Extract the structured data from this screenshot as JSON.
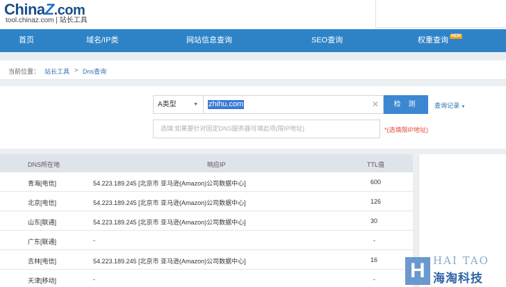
{
  "header": {
    "logo_left": "China",
    "logo_z": "Z",
    "logo_right": ".com",
    "subtitle": "tool.chinaz.com | 站长工具"
  },
  "nav": {
    "items": [
      {
        "label": "首页"
      },
      {
        "label": "域名/IP类"
      },
      {
        "label": "网站信息查询"
      },
      {
        "label": "SEO查询"
      },
      {
        "label": "权重查询"
      }
    ],
    "badge": "NEW"
  },
  "breadcrumb": {
    "prefix": "当前位置：",
    "home": "站长工具",
    "sep": ">",
    "current": "Dns查询"
  },
  "query": {
    "type_value": "A类型",
    "domain_value": "zhihu.com",
    "clear_glyph": "✕",
    "detect_label": "检 测",
    "history_label": "查询记录",
    "dns_placeholder": "选填:如果要针对固定DNS服务器可填此项(限IP地址)",
    "hint": "*(选填限IP地址)"
  },
  "table": {
    "headers": [
      "DNS所在地",
      "响应IP",
      "TTL值"
    ],
    "rows": [
      {
        "location": "青海[电信]",
        "ip": "54.223.189.245 [北京市 亚马逊(Amazon)公司数据中心]",
        "ttl": "600"
      },
      {
        "location": "北京[电信]",
        "ip": "54.223.189.245 [北京市 亚马逊(Amazon)公司数据中心]",
        "ttl": "126"
      },
      {
        "location": "山东[联通]",
        "ip": "54.223.189.245 [北京市 亚马逊(Amazon)公司数据中心]",
        "ttl": "30"
      },
      {
        "location": "广东[联通]",
        "ip": "-",
        "ttl": "-"
      },
      {
        "location": "吉林[电信]",
        "ip": "54.223.189.245 [北京市 亚马逊(Amazon)公司数据中心]",
        "ttl": "16"
      },
      {
        "location": "天津[移动]",
        "ip": "-",
        "ttl": "-"
      }
    ]
  },
  "watermark": {
    "letter": "H",
    "english": "HAI TAO",
    "chinese": "海淘科技"
  },
  "colors": {
    "nav": "#2e83c7",
    "button": "#3c87d2",
    "link": "#2e6fb0",
    "hint": "#e14a3a"
  }
}
